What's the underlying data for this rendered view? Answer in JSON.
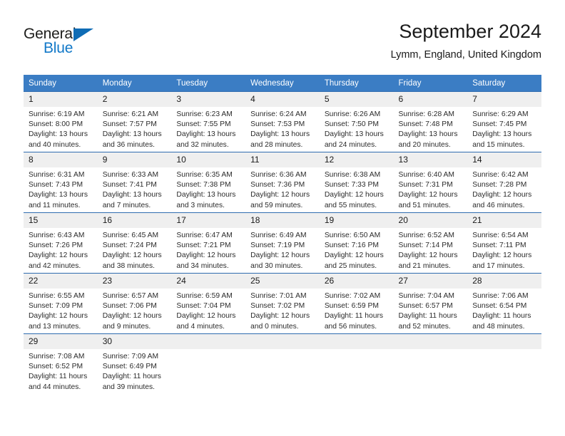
{
  "brand": {
    "name_top": "General",
    "name_bottom": "Blue",
    "accent_color": "#1178c8",
    "triangle_color": "#0f6cb5"
  },
  "header": {
    "title": "September 2024",
    "subtitle": "Lymm, England, United Kingdom"
  },
  "theme": {
    "header_row_bg": "#3b7dc4",
    "header_row_text": "#ffffff",
    "row_separator": "#2f6cb0",
    "daynum_bg": "#efefef",
    "page_bg": "#ffffff",
    "body_text": "#2b2b2b"
  },
  "weekday_headers": [
    "Sunday",
    "Monday",
    "Tuesday",
    "Wednesday",
    "Thursday",
    "Friday",
    "Saturday"
  ],
  "labels": {
    "sunrise_prefix": "Sunrise: ",
    "sunset_prefix": "Sunset: ",
    "daylight_prefix": "Daylight: "
  },
  "weeks": [
    [
      {
        "day": "1",
        "sunrise": "Sunrise: 6:19 AM",
        "sunset": "Sunset: 8:00 PM",
        "daylight": "Daylight: 13 hours and 40 minutes."
      },
      {
        "day": "2",
        "sunrise": "Sunrise: 6:21 AM",
        "sunset": "Sunset: 7:57 PM",
        "daylight": "Daylight: 13 hours and 36 minutes."
      },
      {
        "day": "3",
        "sunrise": "Sunrise: 6:23 AM",
        "sunset": "Sunset: 7:55 PM",
        "daylight": "Daylight: 13 hours and 32 minutes."
      },
      {
        "day": "4",
        "sunrise": "Sunrise: 6:24 AM",
        "sunset": "Sunset: 7:53 PM",
        "daylight": "Daylight: 13 hours and 28 minutes."
      },
      {
        "day": "5",
        "sunrise": "Sunrise: 6:26 AM",
        "sunset": "Sunset: 7:50 PM",
        "daylight": "Daylight: 13 hours and 24 minutes."
      },
      {
        "day": "6",
        "sunrise": "Sunrise: 6:28 AM",
        "sunset": "Sunset: 7:48 PM",
        "daylight": "Daylight: 13 hours and 20 minutes."
      },
      {
        "day": "7",
        "sunrise": "Sunrise: 6:29 AM",
        "sunset": "Sunset: 7:45 PM",
        "daylight": "Daylight: 13 hours and 15 minutes."
      }
    ],
    [
      {
        "day": "8",
        "sunrise": "Sunrise: 6:31 AM",
        "sunset": "Sunset: 7:43 PM",
        "daylight": "Daylight: 13 hours and 11 minutes."
      },
      {
        "day": "9",
        "sunrise": "Sunrise: 6:33 AM",
        "sunset": "Sunset: 7:41 PM",
        "daylight": "Daylight: 13 hours and 7 minutes."
      },
      {
        "day": "10",
        "sunrise": "Sunrise: 6:35 AM",
        "sunset": "Sunset: 7:38 PM",
        "daylight": "Daylight: 13 hours and 3 minutes."
      },
      {
        "day": "11",
        "sunrise": "Sunrise: 6:36 AM",
        "sunset": "Sunset: 7:36 PM",
        "daylight": "Daylight: 12 hours and 59 minutes."
      },
      {
        "day": "12",
        "sunrise": "Sunrise: 6:38 AM",
        "sunset": "Sunset: 7:33 PM",
        "daylight": "Daylight: 12 hours and 55 minutes."
      },
      {
        "day": "13",
        "sunrise": "Sunrise: 6:40 AM",
        "sunset": "Sunset: 7:31 PM",
        "daylight": "Daylight: 12 hours and 51 minutes."
      },
      {
        "day": "14",
        "sunrise": "Sunrise: 6:42 AM",
        "sunset": "Sunset: 7:28 PM",
        "daylight": "Daylight: 12 hours and 46 minutes."
      }
    ],
    [
      {
        "day": "15",
        "sunrise": "Sunrise: 6:43 AM",
        "sunset": "Sunset: 7:26 PM",
        "daylight": "Daylight: 12 hours and 42 minutes."
      },
      {
        "day": "16",
        "sunrise": "Sunrise: 6:45 AM",
        "sunset": "Sunset: 7:24 PM",
        "daylight": "Daylight: 12 hours and 38 minutes."
      },
      {
        "day": "17",
        "sunrise": "Sunrise: 6:47 AM",
        "sunset": "Sunset: 7:21 PM",
        "daylight": "Daylight: 12 hours and 34 minutes."
      },
      {
        "day": "18",
        "sunrise": "Sunrise: 6:49 AM",
        "sunset": "Sunset: 7:19 PM",
        "daylight": "Daylight: 12 hours and 30 minutes."
      },
      {
        "day": "19",
        "sunrise": "Sunrise: 6:50 AM",
        "sunset": "Sunset: 7:16 PM",
        "daylight": "Daylight: 12 hours and 25 minutes."
      },
      {
        "day": "20",
        "sunrise": "Sunrise: 6:52 AM",
        "sunset": "Sunset: 7:14 PM",
        "daylight": "Daylight: 12 hours and 21 minutes."
      },
      {
        "day": "21",
        "sunrise": "Sunrise: 6:54 AM",
        "sunset": "Sunset: 7:11 PM",
        "daylight": "Daylight: 12 hours and 17 minutes."
      }
    ],
    [
      {
        "day": "22",
        "sunrise": "Sunrise: 6:55 AM",
        "sunset": "Sunset: 7:09 PM",
        "daylight": "Daylight: 12 hours and 13 minutes."
      },
      {
        "day": "23",
        "sunrise": "Sunrise: 6:57 AM",
        "sunset": "Sunset: 7:06 PM",
        "daylight": "Daylight: 12 hours and 9 minutes."
      },
      {
        "day": "24",
        "sunrise": "Sunrise: 6:59 AM",
        "sunset": "Sunset: 7:04 PM",
        "daylight": "Daylight: 12 hours and 4 minutes."
      },
      {
        "day": "25",
        "sunrise": "Sunrise: 7:01 AM",
        "sunset": "Sunset: 7:02 PM",
        "daylight": "Daylight: 12 hours and 0 minutes."
      },
      {
        "day": "26",
        "sunrise": "Sunrise: 7:02 AM",
        "sunset": "Sunset: 6:59 PM",
        "daylight": "Daylight: 11 hours and 56 minutes."
      },
      {
        "day": "27",
        "sunrise": "Sunrise: 7:04 AM",
        "sunset": "Sunset: 6:57 PM",
        "daylight": "Daylight: 11 hours and 52 minutes."
      },
      {
        "day": "28",
        "sunrise": "Sunrise: 7:06 AM",
        "sunset": "Sunset: 6:54 PM",
        "daylight": "Daylight: 11 hours and 48 minutes."
      }
    ],
    [
      {
        "day": "29",
        "sunrise": "Sunrise: 7:08 AM",
        "sunset": "Sunset: 6:52 PM",
        "daylight": "Daylight: 11 hours and 44 minutes."
      },
      {
        "day": "30",
        "sunrise": "Sunrise: 7:09 AM",
        "sunset": "Sunset: 6:49 PM",
        "daylight": "Daylight: 11 hours and 39 minutes."
      },
      {
        "day": "",
        "sunrise": "",
        "sunset": "",
        "daylight": ""
      },
      {
        "day": "",
        "sunrise": "",
        "sunset": "",
        "daylight": ""
      },
      {
        "day": "",
        "sunrise": "",
        "sunset": "",
        "daylight": ""
      },
      {
        "day": "",
        "sunrise": "",
        "sunset": "",
        "daylight": ""
      },
      {
        "day": "",
        "sunrise": "",
        "sunset": "",
        "daylight": ""
      }
    ]
  ]
}
